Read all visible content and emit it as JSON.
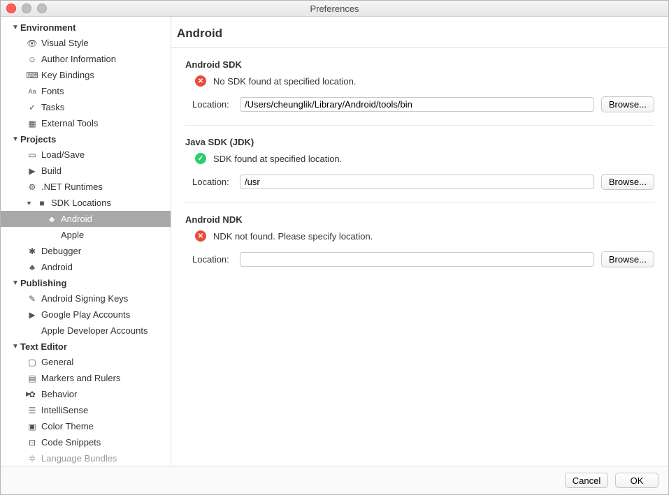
{
  "window": {
    "title": "Preferences"
  },
  "sidebar": {
    "environment": {
      "label": "Environment",
      "items": [
        {
          "label": "Visual Style",
          "icon": "eye"
        },
        {
          "label": "Author Information",
          "icon": "smiley"
        },
        {
          "label": "Key Bindings",
          "icon": "keyboard"
        },
        {
          "label": "Fonts",
          "icon": "Aa"
        },
        {
          "label": "Tasks",
          "icon": "check"
        },
        {
          "label": "External Tools",
          "icon": "tools"
        }
      ]
    },
    "projects": {
      "label": "Projects",
      "items": [
        {
          "label": "Load/Save",
          "icon": "disk"
        },
        {
          "label": "Build",
          "icon": "play"
        },
        {
          "label": ".NET Runtimes",
          "icon": "gear"
        },
        {
          "label": "SDK Locations",
          "icon": "folder",
          "children": [
            {
              "label": "Android",
              "icon": "android",
              "selected": true
            },
            {
              "label": "Apple",
              "icon": "apple"
            }
          ]
        },
        {
          "label": "Debugger",
          "icon": "bug"
        },
        {
          "label": "Android",
          "icon": "android"
        }
      ]
    },
    "publishing": {
      "label": "Publishing",
      "items": [
        {
          "label": "Android Signing Keys",
          "icon": "key"
        },
        {
          "label": "Google Play Accounts",
          "icon": "play"
        },
        {
          "label": "Apple Developer Accounts",
          "icon": "apple"
        }
      ]
    },
    "textEditor": {
      "label": "Text Editor",
      "items": [
        {
          "label": "General",
          "icon": "doc"
        },
        {
          "label": "Markers and Rulers",
          "icon": "ruler"
        },
        {
          "label": "Behavior",
          "icon": "brain",
          "collapsed": true
        },
        {
          "label": "IntelliSense",
          "icon": "list"
        },
        {
          "label": "Color Theme",
          "icon": "palette"
        },
        {
          "label": "Code Snippets",
          "icon": "snippet"
        },
        {
          "label": "Language Bundles",
          "icon": "bundle"
        }
      ]
    }
  },
  "page": {
    "title": "Android",
    "sections": {
      "androidSdk": {
        "title": "Android SDK",
        "status": "error",
        "statusText": "No SDK found at specified location.",
        "locationLabel": "Location:",
        "locationValue": "/Users/cheunglik/Library/Android/tools/bin",
        "browse": "Browse..."
      },
      "javaSdk": {
        "title": "Java SDK (JDK)",
        "status": "ok",
        "statusText": "SDK found at specified location.",
        "locationLabel": "Location:",
        "locationValue": "/usr",
        "browse": "Browse..."
      },
      "androidNdk": {
        "title": "Android NDK",
        "status": "error",
        "statusText": "NDK not found. Please specify location.",
        "locationLabel": "Location:",
        "locationValue": "",
        "browse": "Browse..."
      }
    }
  },
  "footer": {
    "cancel": "Cancel",
    "ok": "OK"
  }
}
